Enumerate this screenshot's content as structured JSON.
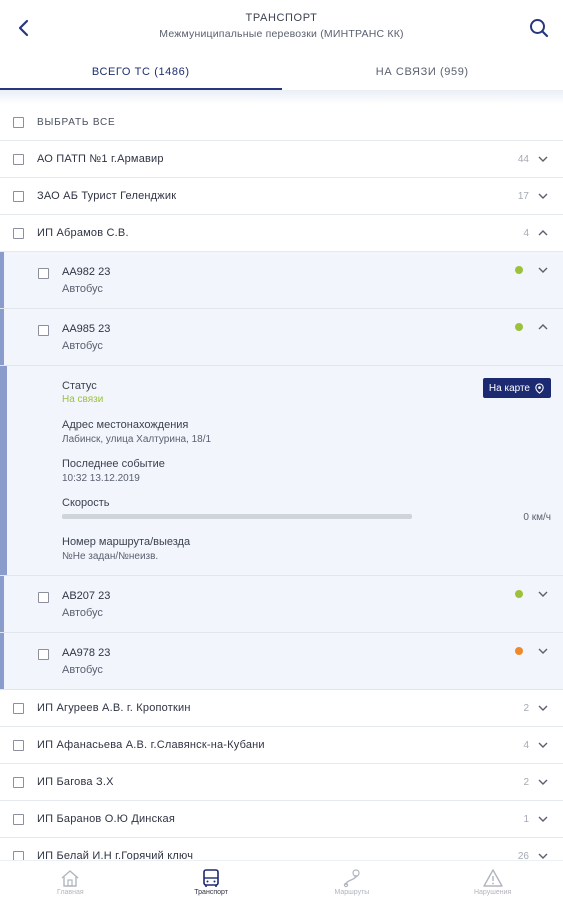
{
  "header": {
    "title": "ТРАНСПОРТ",
    "subtitle": "Межмуниципальные перевозки (МИНТРАНС КК)",
    "back_icon": "chevron-left-icon",
    "search_icon": "search-icon"
  },
  "tabs": [
    {
      "label": "ВСЕГО ТС (1486)",
      "active": true
    },
    {
      "label": "НА СВЯЗИ (959)",
      "active": false
    }
  ],
  "select_all": "ВЫБРАТЬ ВСЕ",
  "groups_top": [
    {
      "name": "АО ПАТП №1 г.Армавир",
      "count": "44"
    },
    {
      "name": "ЗАО АБ Турист Геленджик",
      "count": "17"
    },
    {
      "name": "ИП Абрамов С.В.",
      "count": "4"
    }
  ],
  "vehicles": [
    {
      "plate": "АА982 23",
      "type": "Автобус",
      "status_color": "#9bc23a"
    },
    {
      "plate": "АА985 23",
      "type": "Автобус",
      "status_color": "#9bc23a"
    },
    {
      "plate": "АВ207 23",
      "type": "Автобус",
      "status_color": "#9bc23a"
    },
    {
      "plate": "АА978 23",
      "type": "Автобус",
      "status_color": "#f0892b"
    }
  ],
  "detail": {
    "status_label": "Статус",
    "status_value": "На связи",
    "map_button": "На карте",
    "address_label": "Адрес местонахождения",
    "address_value": "Лабинск, улица Халтурина, 18/1",
    "event_label": "Последнее событие",
    "event_value": "10:32 13.12.2019",
    "speed_label": "Скорость",
    "speed_value": "0 км/ч",
    "speed_fraction": 0,
    "route_label": "Номер маршрута/выезда",
    "route_value": "№Не задан/№неизв."
  },
  "groups_bottom": [
    {
      "name": "ИП Агуреев А.В. г. Кропоткин",
      "count": "2"
    },
    {
      "name": "ИП Афанасьева А.В. г.Славянск-на-Кубани",
      "count": "4"
    },
    {
      "name": "ИП Багова З.Х",
      "count": "2"
    },
    {
      "name": "ИП Баранов О.Ю Динская",
      "count": "1"
    },
    {
      "name": "ИП Белай И.Н г.Горячий ключ",
      "count": "26"
    }
  ],
  "bottom_nav": [
    {
      "label": "Главная",
      "icon": "home-icon",
      "active": false
    },
    {
      "label": "Транспорт",
      "icon": "bus-icon",
      "active": true
    },
    {
      "label": "Маршруты",
      "icon": "route-icon",
      "active": false
    },
    {
      "label": "Нарушения",
      "icon": "warning-icon",
      "active": false
    }
  ],
  "colors": {
    "accent": "#1c2a72",
    "online": "#9bc23a",
    "warning": "#f0892b"
  }
}
